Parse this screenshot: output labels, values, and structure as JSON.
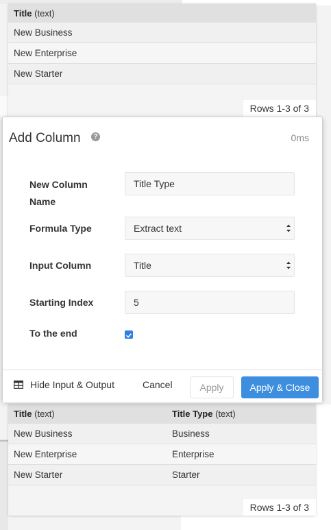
{
  "top_table": {
    "header": {
      "col_title": "Title",
      "col_title_type": "(text)"
    },
    "rows": [
      "New Business",
      "New Enterprise",
      "New Starter"
    ],
    "rows_count": "Rows 1-3 of 3"
  },
  "modal": {
    "title": "Add Column",
    "timing": "0ms",
    "fields": {
      "new_column_name_label_line1": "New Column",
      "new_column_name_label_line2": "Name",
      "new_column_name_value": "Title Type",
      "formula_type_label": "Formula Type",
      "formula_type_value": "Extract text",
      "input_column_label": "Input Column",
      "input_column_value": "Title",
      "starting_index_label": "Starting Index",
      "starting_index_value": "5",
      "to_the_end_label": "To the end",
      "to_the_end_checked": true
    },
    "footer": {
      "hide_io_label": "Hide Input & Output",
      "cancel_label": "Cancel",
      "apply_label": "Apply",
      "apply_close_label": "Apply & Close"
    }
  },
  "bottom_table": {
    "header": {
      "col1_title": "Title",
      "col1_type": "(text)",
      "col2_title": "Title Type",
      "col2_type": "(text)"
    },
    "rows": [
      [
        "New Business",
        "Business"
      ],
      [
        "New Enterprise",
        "Enterprise"
      ],
      [
        "New Starter",
        "Starter"
      ]
    ],
    "rows_count": "Rows 1-3 of 3"
  },
  "colors": {
    "accent": "#3e8ee0",
    "checkbox": "#2d7fe0"
  }
}
